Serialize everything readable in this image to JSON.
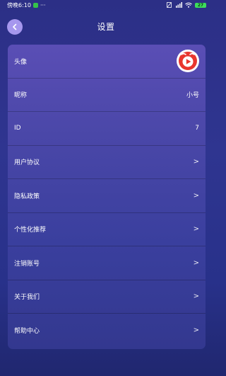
{
  "status_bar": {
    "time": "傍晚6:10",
    "dots": "···",
    "battery": "27"
  },
  "header": {
    "title": "设置",
    "back_icon": "chevron-left-icon"
  },
  "rows": [
    {
      "label": "头像",
      "value": "",
      "type": "avatar"
    },
    {
      "label": "昵称",
      "value": "小号",
      "type": "value"
    },
    {
      "label": "ID",
      "value": "7",
      "type": "value"
    },
    {
      "label": "用户协议",
      "value": ">",
      "type": "chevron"
    },
    {
      "label": "隐私政策",
      "value": ">",
      "type": "chevron"
    },
    {
      "label": "个性化推荐",
      "value": ">",
      "type": "chevron"
    },
    {
      "label": "注销账号",
      "value": ">",
      "type": "chevron"
    },
    {
      "label": "关于我们",
      "value": ">",
      "type": "chevron"
    },
    {
      "label": "帮助中心",
      "value": ">",
      "type": "chevron"
    }
  ],
  "colors": {
    "accent": "#a697ee",
    "avatar_red": "#e8362e"
  }
}
